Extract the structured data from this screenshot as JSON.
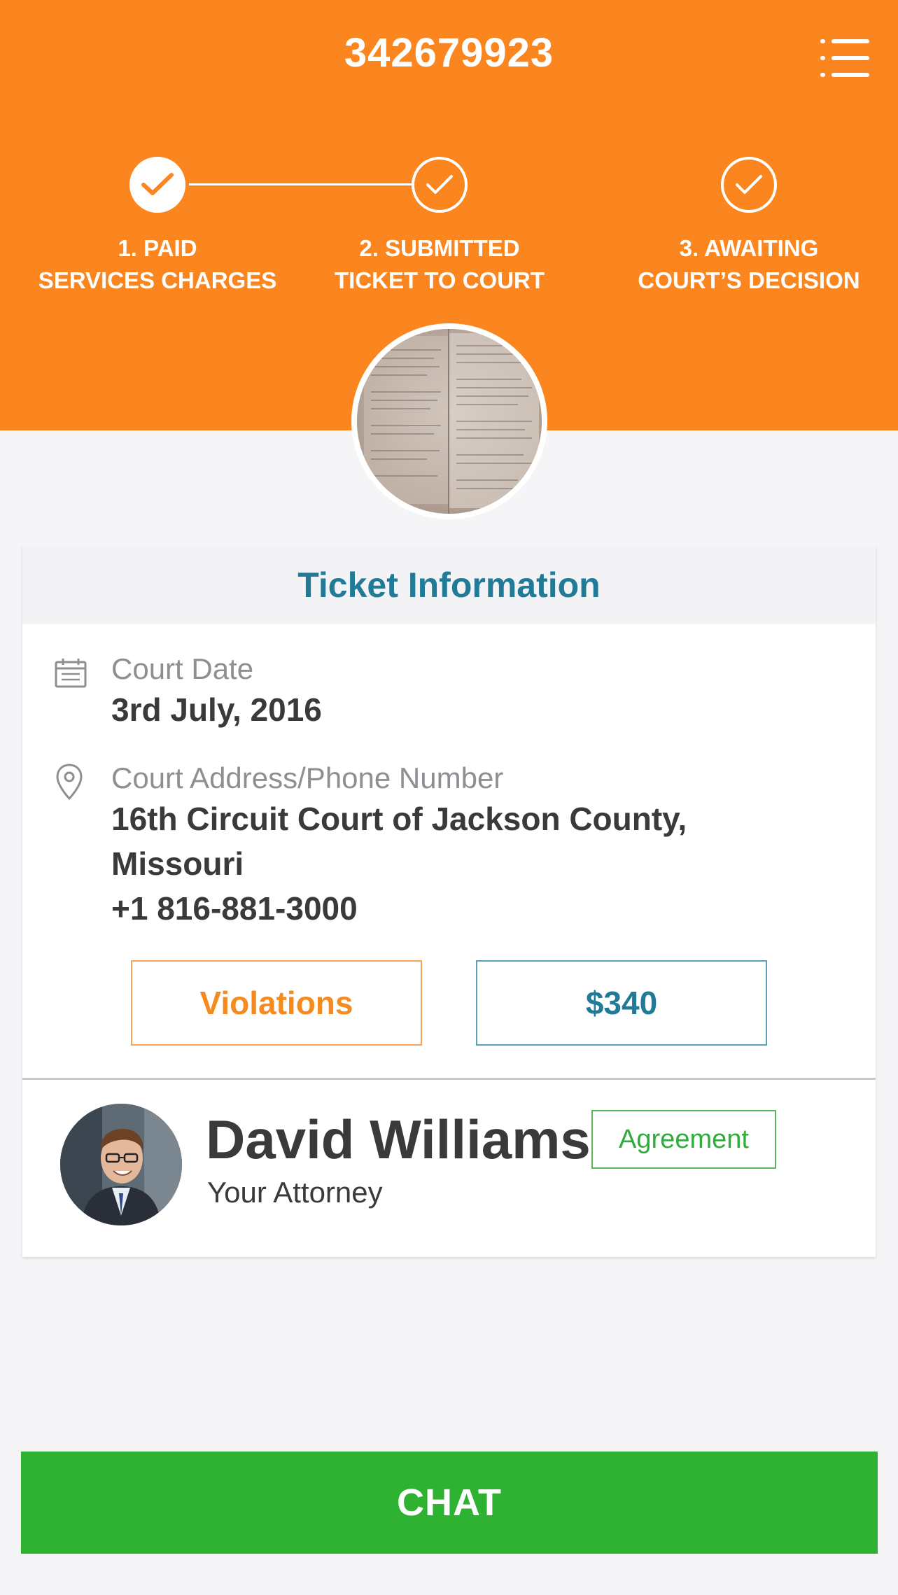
{
  "header": {
    "ticket_number": "342679923",
    "menu_icon": "hamburger-list-icon"
  },
  "steps": [
    {
      "label": "1. PAID\nSERVICES CHARGES",
      "state": "completed"
    },
    {
      "label": "2. SUBMITTED\nTICKET TO COURT",
      "state": "completed"
    },
    {
      "label": "3. AWAITING\nCOURT’S DECISION",
      "state": "pending"
    }
  ],
  "ticket_card": {
    "title": "Ticket Information",
    "court_date": {
      "icon": "calendar-icon",
      "label": "Court Date",
      "value": "3rd July, 2016"
    },
    "court_address": {
      "icon": "location-pin-icon",
      "label": "Court Address/Phone Number",
      "line1": "16th Circuit Court of Jackson County,",
      "line2": "Missouri",
      "phone": "+1 816-881-3000"
    },
    "violations_label": "Violations",
    "amount_label": "$340"
  },
  "attorney": {
    "name": "David Williams",
    "role": "Your Attorney",
    "agreement_label": "Agreement"
  },
  "chat_label": "CHAT",
  "colors": {
    "header_orange": "#fb861f",
    "title_teal": "#217a96",
    "chat_green": "#2fb232"
  }
}
